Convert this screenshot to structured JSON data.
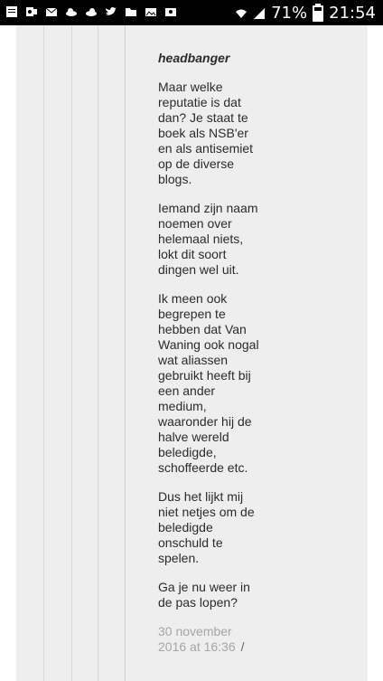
{
  "status_bar": {
    "battery_percent": "71%",
    "time": "21:54",
    "left_icons": [
      "notes-icon",
      "outlook-icon",
      "mail-icon",
      "cloud-icon",
      "cloud-icon-2",
      "twitter-icon",
      "folder-icon",
      "photo-icon",
      "photo-icon-2"
    ]
  },
  "comment": {
    "author": "headbanger",
    "paragraphs": [
      "Maar welke reputatie is dat dan? Je staat te boek als NSB'er en als antisemiet op de diverse blogs.",
      "Iemand zijn naam noemen over helemaal niets, lokt dit soort dingen wel uit.",
      "Ik meen ook begrepen te hebben dat Van Waning ook nogal wat aliassen gebruikt heeft bij een ander medium, waaronder hij de halve wereld beledigde, schoffeerde etc.",
      "Dus het lijkt mij niet netjes om de beledigde onschuld te spelen.",
      "Ga je nu weer in de pas lopen?"
    ],
    "date": "30 november 2016 at 16:36",
    "separator": "/"
  }
}
